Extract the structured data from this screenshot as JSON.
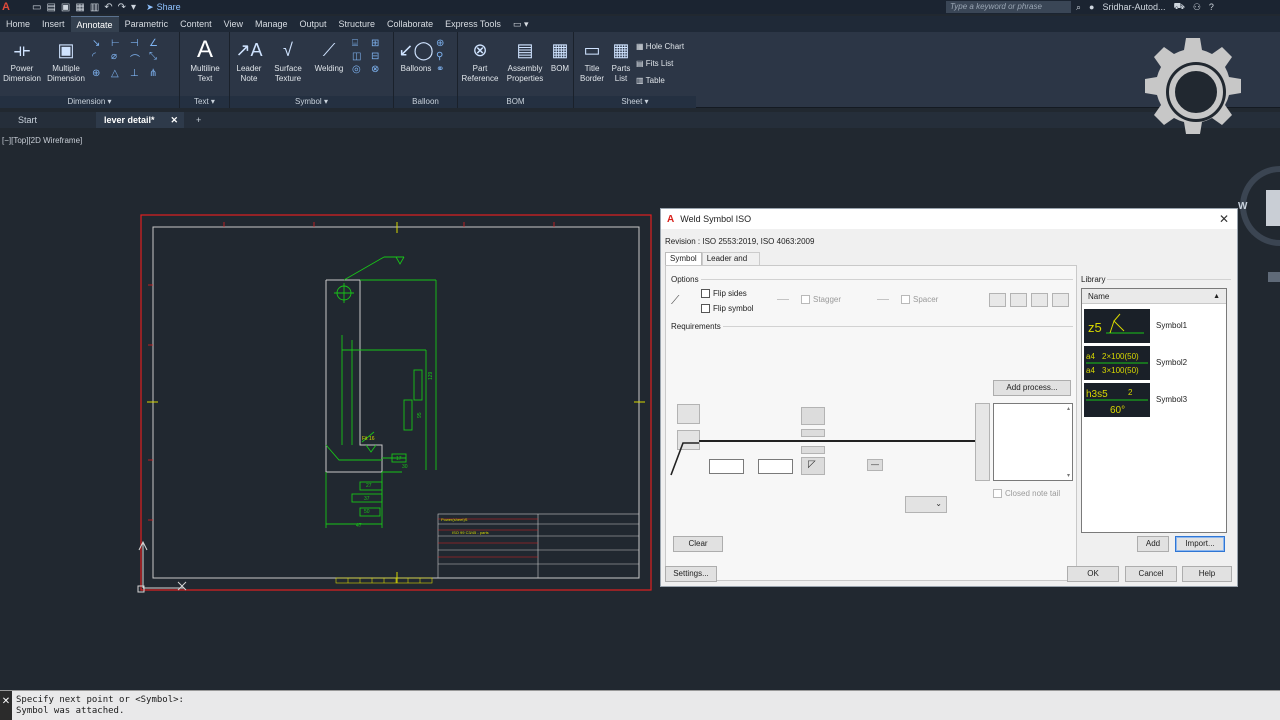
{
  "app": {
    "logo": "A",
    "share_label": "Share",
    "search_placeholder": "Type a keyword or phrase",
    "user": "Sridhar-Autod..."
  },
  "ribbon_tabs": [
    "Home",
    "Insert",
    "Annotate",
    "Parametric",
    "Content",
    "View",
    "Manage",
    "Output",
    "Structure",
    "Collaborate",
    "Express Tools"
  ],
  "ribbon_active": "Annotate",
  "ribbon": {
    "dimension": {
      "label": "Dimension",
      "power": [
        "Power",
        "Dimension"
      ],
      "multiple": [
        "Multiple",
        "Dimension"
      ]
    },
    "text": {
      "label": "Text",
      "multiline": [
        "Multiline",
        "Text"
      ]
    },
    "symbol": {
      "label": "Symbol",
      "leader": [
        "Leader",
        "Note"
      ],
      "surface": [
        "Surface",
        "Texture"
      ],
      "welding": "Welding"
    },
    "balloon": {
      "label": "Balloon",
      "balloons": "Balloons"
    },
    "bom": {
      "label": "BOM",
      "part": [
        "Part",
        "Reference"
      ],
      "assembly": [
        "Assembly",
        "Properties"
      ],
      "bom": "BOM"
    },
    "sheet": {
      "label": "Sheet",
      "title": [
        "Title",
        "Border"
      ],
      "parts": [
        "Parts",
        "List"
      ],
      "hole": "Hole Chart",
      "fits": "Fits List",
      "table": "Table"
    }
  },
  "doc_tabs": {
    "start": "Start",
    "active": "lever detail*"
  },
  "viewport_label": "[−][Top][2D Wireframe]",
  "dialog": {
    "title": "Weld Symbol ISO",
    "revision": "Revision : ISO 2553:2019, ISO 4063:2009",
    "tabs": [
      "Symbol",
      "Leader and Text"
    ],
    "options_label": "Options",
    "flip_sides": "Flip sides",
    "flip_symbol": "Flip symbol",
    "stagger": "Stagger",
    "spacer": "Spacer",
    "requirements_label": "Requirements",
    "add_process": "Add process...",
    "closed_note_tail": "Closed note tail",
    "clear": "Clear",
    "library_label": "Library",
    "name_header": "Name",
    "library": [
      {
        "name": "Symbol1",
        "t1": "z5"
      },
      {
        "name": "Symbol2",
        "t1": "a4",
        "t2": "2×100(50)",
        "t3": "a4",
        "t4": "3×100(50)"
      },
      {
        "name": "Symbol3",
        "t1": "h3s5",
        "t2": "2",
        "t3": "60°"
      }
    ],
    "add": "Add",
    "import": "Import...",
    "settings": "Settings...",
    "ok": "OK",
    "cancel": "Cancel",
    "help": "Help"
  },
  "drawing": {
    "dims": [
      "129",
      "95",
      "17",
      "27",
      "30",
      "37",
      "47",
      "50"
    ],
    "callout": "Fit 16",
    "tb_title": "Power(sheet)S",
    "tb_sub": "ISO 99 C3/45 - parts"
  },
  "command": {
    "line1": "Specify next point or <Symbol>:",
    "line2": "Symbol was attached."
  },
  "colors": {
    "accent": "#2f76d4",
    "drawing_border": "#e02020",
    "geometry": "#18c418",
    "title_block": "#d8d800"
  }
}
